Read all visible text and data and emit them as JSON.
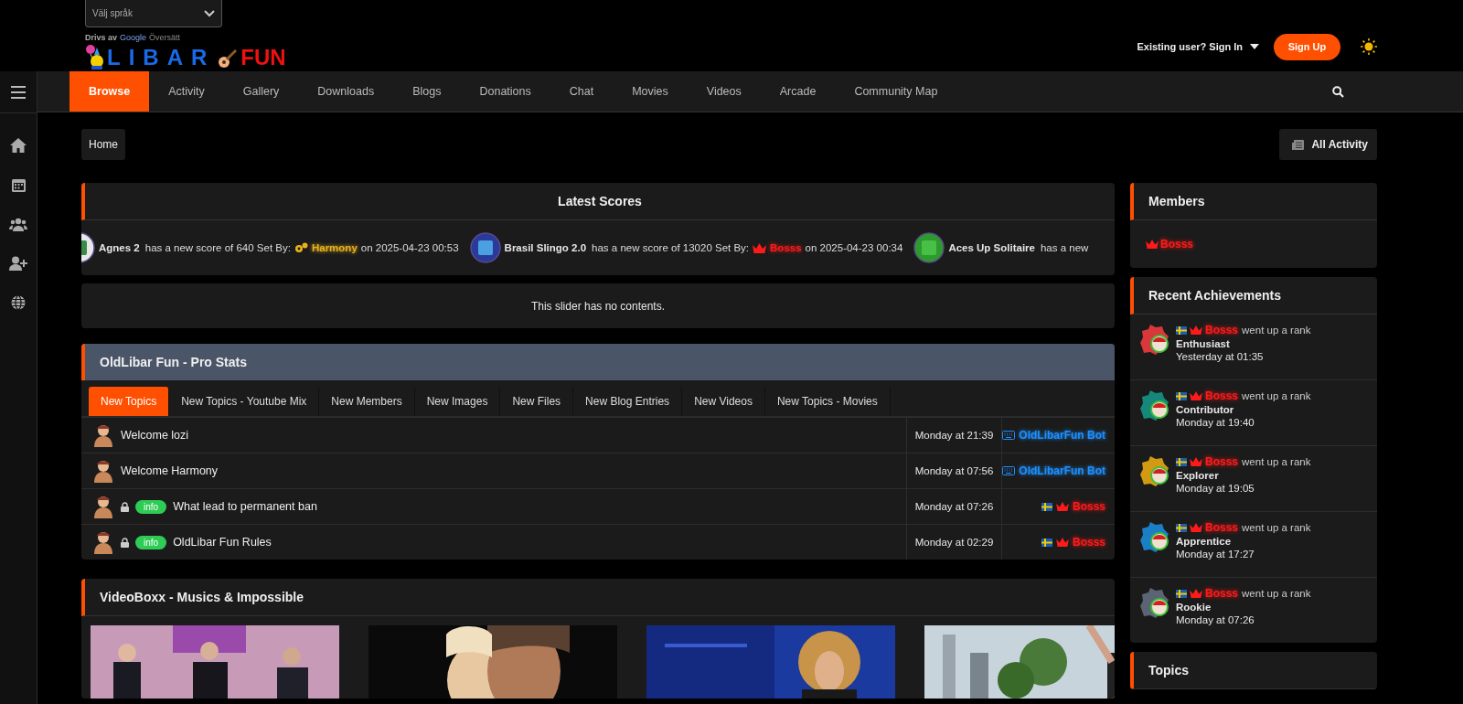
{
  "language_select": {
    "placeholder": "Välj språk"
  },
  "translate_credit": {
    "prefix": "Drivs av",
    "brand": "Google",
    "suffix": "Översätt"
  },
  "logo": {
    "part_1": "LIBAR",
    "part_2": "FUN"
  },
  "account": {
    "sign_in": "Existing user? Sign In",
    "sign_up": "Sign Up"
  },
  "nav_tabs": [
    {
      "label": "Browse",
      "selected": true
    },
    {
      "label": "Activity",
      "selected": false
    },
    {
      "label": "Gallery",
      "selected": false
    },
    {
      "label": "Downloads",
      "selected": false
    },
    {
      "label": "Blogs",
      "selected": false
    },
    {
      "label": "Donations",
      "selected": false
    },
    {
      "label": "Chat",
      "selected": false
    },
    {
      "label": "Movies",
      "selected": false
    },
    {
      "label": "Videos",
      "selected": false
    },
    {
      "label": "Arcade",
      "selected": false
    },
    {
      "label": "Community Map",
      "selected": false
    }
  ],
  "breadcrumb": [
    "Home"
  ],
  "all_activity": "All Activity",
  "latest_scores": {
    "title": "Latest Scores",
    "items": [
      {
        "game": "Agnes 2",
        "score_text": "has a new score of 640 Set By:",
        "user": "Harmony",
        "kind": "moderator",
        "date": "on 2025-04-23 00:53"
      },
      {
        "game": "Brasil Slingo 2.0",
        "score_text": "has a new score of 13020 Set By:",
        "user": "Bosss",
        "kind": "admin",
        "date": "on 2025-04-23 00:34"
      },
      {
        "game": "Aces Up Solitaire",
        "score_text": "has a new"
      }
    ]
  },
  "slider_message": "This slider has no contents.",
  "pro_stats": {
    "title": "OldLibar Fun - Pro Stats",
    "tabs": [
      {
        "label": "New Topics",
        "selected": true
      },
      {
        "label": "New Topics - Youtube Mix",
        "selected": false
      },
      {
        "label": "New Members",
        "selected": false
      },
      {
        "label": "New Images",
        "selected": false
      },
      {
        "label": "New Files",
        "selected": false
      },
      {
        "label": "New Blog Entries",
        "selected": false
      },
      {
        "label": "New Videos",
        "selected": false
      },
      {
        "label": "New Topics - Movies",
        "selected": false
      }
    ],
    "topics": [
      {
        "title": "Welcome lozi",
        "locked": false,
        "time": "Monday at 21:39",
        "author": "OldLibarFun Bot",
        "kind": "bot"
      },
      {
        "title": "Welcome Harmony",
        "locked": false,
        "time": "Monday at 07:56",
        "author": "OldLibarFun Bot",
        "kind": "bot"
      },
      {
        "title": "What lead to permanent ban",
        "locked": true,
        "badge": "info",
        "time": "Monday at 07:26",
        "author": "Bosss",
        "kind": "admin"
      },
      {
        "title": "OldLibar Fun Rules",
        "locked": true,
        "badge": "info",
        "time": "Monday at 02:29",
        "author": "Bosss",
        "kind": "admin"
      }
    ]
  },
  "videos": {
    "title": "VideoBoxx - Musics & Impossible"
  },
  "members": {
    "title": "Members",
    "online": [
      "Bosss"
    ]
  },
  "achievements": {
    "title": "Recent Achievements",
    "items": [
      {
        "user": "Bosss",
        "action": "went up a rank",
        "rank": "Enthusiast",
        "time": "Yesterday at 01:35",
        "color": "#d9383a"
      },
      {
        "user": "Bosss",
        "action": "went up a rank",
        "rank": "Contributor",
        "time": "Monday at 19:40",
        "color": "#16887a"
      },
      {
        "user": "Bosss",
        "action": "went up a rank",
        "rank": "Explorer",
        "time": "Monday at 19:05",
        "color": "#d19a12"
      },
      {
        "user": "Bosss",
        "action": "went up a rank",
        "rank": "Apprentice",
        "time": "Monday at 17:27",
        "color": "#1a7fc4"
      },
      {
        "user": "Bosss",
        "action": "went up a rank",
        "rank": "Rookie",
        "time": "Monday at 07:26",
        "color": "#5b6472"
      }
    ]
  },
  "topics_panel": {
    "title": "Topics"
  }
}
